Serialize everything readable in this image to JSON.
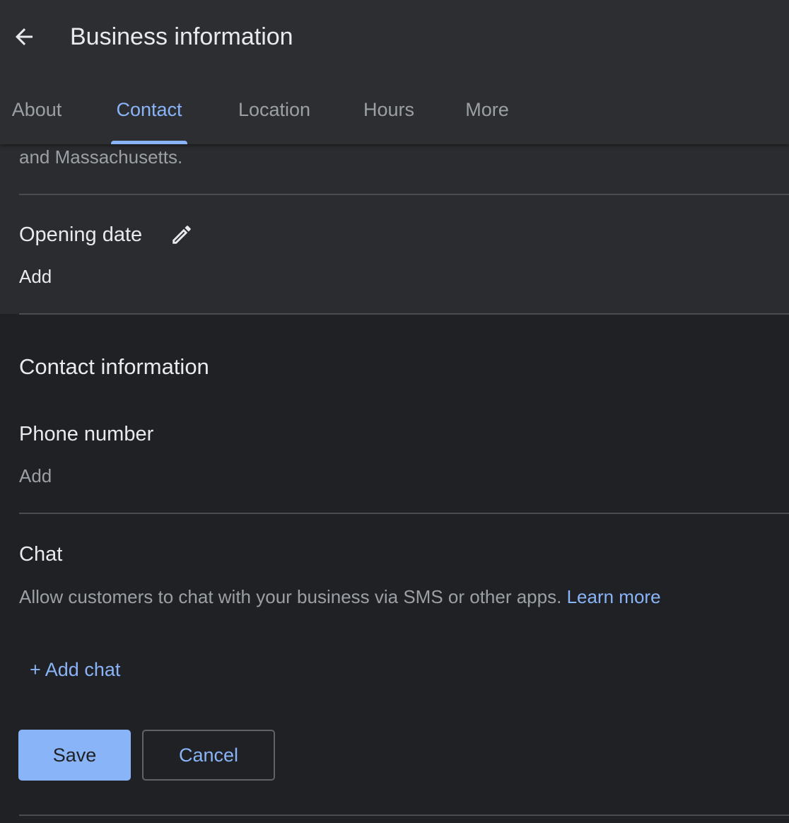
{
  "header": {
    "title": "Business information",
    "back_icon": "arrow-left-icon"
  },
  "tabs": [
    {
      "label": "About",
      "active": false
    },
    {
      "label": "Contact",
      "active": true
    },
    {
      "label": "Location",
      "active": false
    },
    {
      "label": "Hours",
      "active": false
    },
    {
      "label": "More",
      "active": false
    }
  ],
  "description_tail": "and Massachusetts.",
  "opening_date": {
    "label": "Opening date",
    "value": "Add",
    "edit_icon": "pencil-icon"
  },
  "contact_info": {
    "title": "Contact information",
    "phone": {
      "label": "Phone number",
      "value": "Add"
    },
    "chat": {
      "label": "Chat",
      "description": "Allow customers to chat with your business via SMS or other apps.",
      "learn_more": "Learn more",
      "add_chat": "+ Add chat"
    }
  },
  "actions": {
    "save": "Save",
    "cancel": "Cancel"
  },
  "colors": {
    "accent": "#8ab4f8",
    "background": "#202124",
    "header": "#2d2e31"
  }
}
